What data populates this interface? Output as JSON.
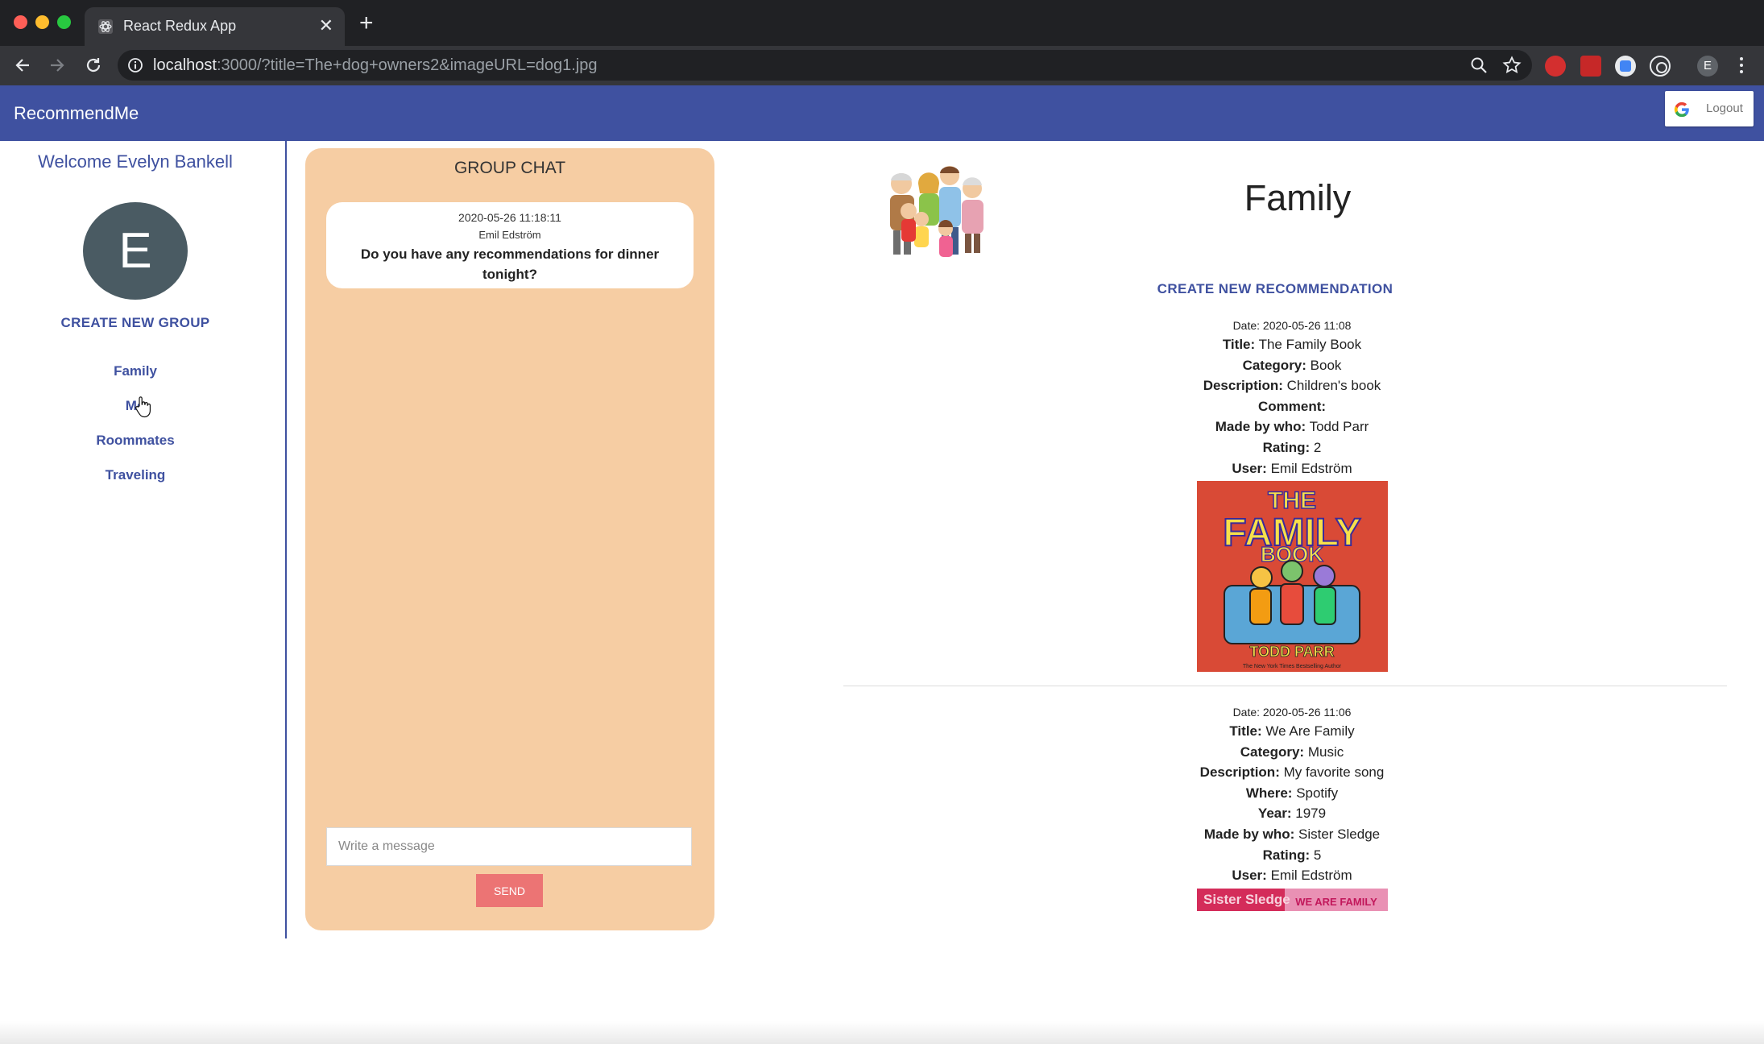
{
  "browser": {
    "tab_title": "React Redux App",
    "url_host": "localhost",
    "url_rest": ":3000/?title=The+dog+owners2&imageURL=dog1.jpg",
    "profile_initial": "E"
  },
  "app": {
    "brand": "RecommendMe",
    "logout_label": "Logout",
    "accent_color": "#3f51a0"
  },
  "sidebar": {
    "welcome": "Welcome Evelyn Bankell",
    "avatar_initial": "E",
    "create_group_label": "CREATE NEW GROUP",
    "groups": [
      "Family",
      "Mo",
      "Roommates",
      "Traveling"
    ]
  },
  "chat": {
    "title": "GROUP CHAT",
    "messages": [
      {
        "time": "2020-05-26 11:18:11",
        "user": "Emil Edström",
        "text": "Do you have any recommendations for dinner tonight?"
      }
    ],
    "input_placeholder": "Write a message",
    "send_label": "SEND"
  },
  "group": {
    "title": "Family",
    "create_recommendation_label": "CREATE NEW RECOMMENDATION"
  },
  "recommendations": [
    {
      "date": "Date: 2020-05-26 11:08",
      "fields": [
        {
          "label": "Title:",
          "value": "The Family Book"
        },
        {
          "label": "Category:",
          "value": "Book"
        },
        {
          "label": "Description:",
          "value": "Children's book"
        },
        {
          "label": "Comment:",
          "value": ""
        },
        {
          "label": "Made by who:",
          "value": "Todd Parr"
        },
        {
          "label": "Rating:",
          "value": "2"
        },
        {
          "label": "User:",
          "value": "Emil Edström"
        }
      ],
      "cover": {
        "line1": "THE",
        "line2": "FAMILY",
        "line3": "BOOK",
        "author": "TODD PARR",
        "tagline": "The New York Times Bestselling Author"
      }
    },
    {
      "date": "Date: 2020-05-26 11:06",
      "fields": [
        {
          "label": "Title:",
          "value": "We Are Family"
        },
        {
          "label": "Category:",
          "value": "Music"
        },
        {
          "label": "Description:",
          "value": "My favorite song"
        },
        {
          "label": "Where:",
          "value": "Spotify"
        },
        {
          "label": "Year:",
          "value": "1979"
        },
        {
          "label": "Made by who:",
          "value": "Sister Sledge"
        },
        {
          "label": "Rating:",
          "value": "5"
        },
        {
          "label": "User:",
          "value": "Emil Edström"
        }
      ],
      "cover": {
        "left_text": "Sister Sledge",
        "right_text": "WE ARE FAMILY"
      }
    }
  ]
}
